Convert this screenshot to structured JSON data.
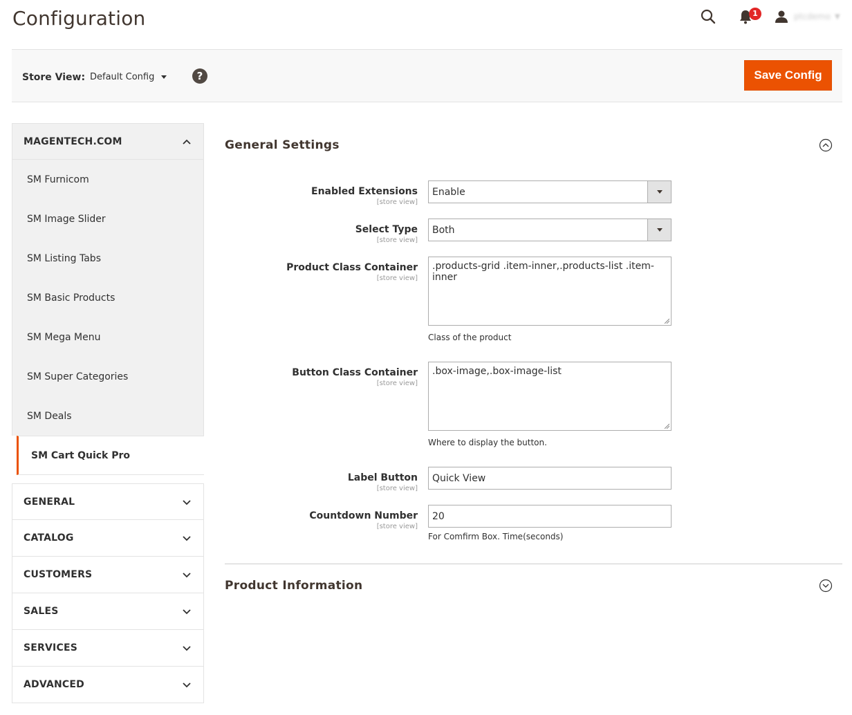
{
  "header": {
    "title": "Configuration",
    "notification_count": "1",
    "user_name": "ptcdemo",
    "icons": {
      "search": "search-icon",
      "bell": "bell-icon",
      "user": "user-icon"
    }
  },
  "store_bar": {
    "label": "Store View:",
    "selected": "Default Config",
    "help": "?",
    "save_label": "Save Config"
  },
  "sidebar": {
    "group": {
      "title": "MAGENTECH.COM",
      "items": [
        {
          "label": "SM Furnicom",
          "active": false
        },
        {
          "label": "SM Image Slider",
          "active": false
        },
        {
          "label": "SM Listing Tabs",
          "active": false
        },
        {
          "label": "SM Basic Products",
          "active": false
        },
        {
          "label": "SM Mega Menu",
          "active": false
        },
        {
          "label": "SM Super Categories",
          "active": false
        },
        {
          "label": "SM Deals",
          "active": false
        },
        {
          "label": "SM Cart Quick Pro",
          "active": true
        }
      ]
    },
    "sections": [
      "GENERAL",
      "CATALOG",
      "CUSTOMERS",
      "SALES",
      "SERVICES",
      "ADVANCED"
    ]
  },
  "main": {
    "general_settings": {
      "title": "General Settings",
      "fields": {
        "enabled_extensions": {
          "label": "Enabled Extensions",
          "scope": "[store view]",
          "value": "Enable"
        },
        "select_type": {
          "label": "Select Type",
          "scope": "[store view]",
          "value": "Both"
        },
        "product_class": {
          "label": "Product Class Container",
          "scope": "[store view]",
          "value": ".products-grid .item-inner,.products-list .item-inner",
          "note": "Class of the product"
        },
        "button_class": {
          "label": "Button Class Container",
          "scope": "[store view]",
          "value": ".box-image,.box-image-list",
          "note": "Where to display the button."
        },
        "label_button": {
          "label": "Label Button",
          "scope": "[store view]",
          "value": "Quick View"
        },
        "countdown": {
          "label": "Countdown Number",
          "scope": "[store view]",
          "value": "20",
          "note": "For Comfirm Box. Time(seconds)"
        }
      }
    },
    "product_information": {
      "title": "Product Information"
    }
  },
  "colors": {
    "accent": "#eb5202",
    "badge": "#e22626",
    "sidebar_bg": "#f1f1f1",
    "bar_bg": "#f8f8f8"
  }
}
